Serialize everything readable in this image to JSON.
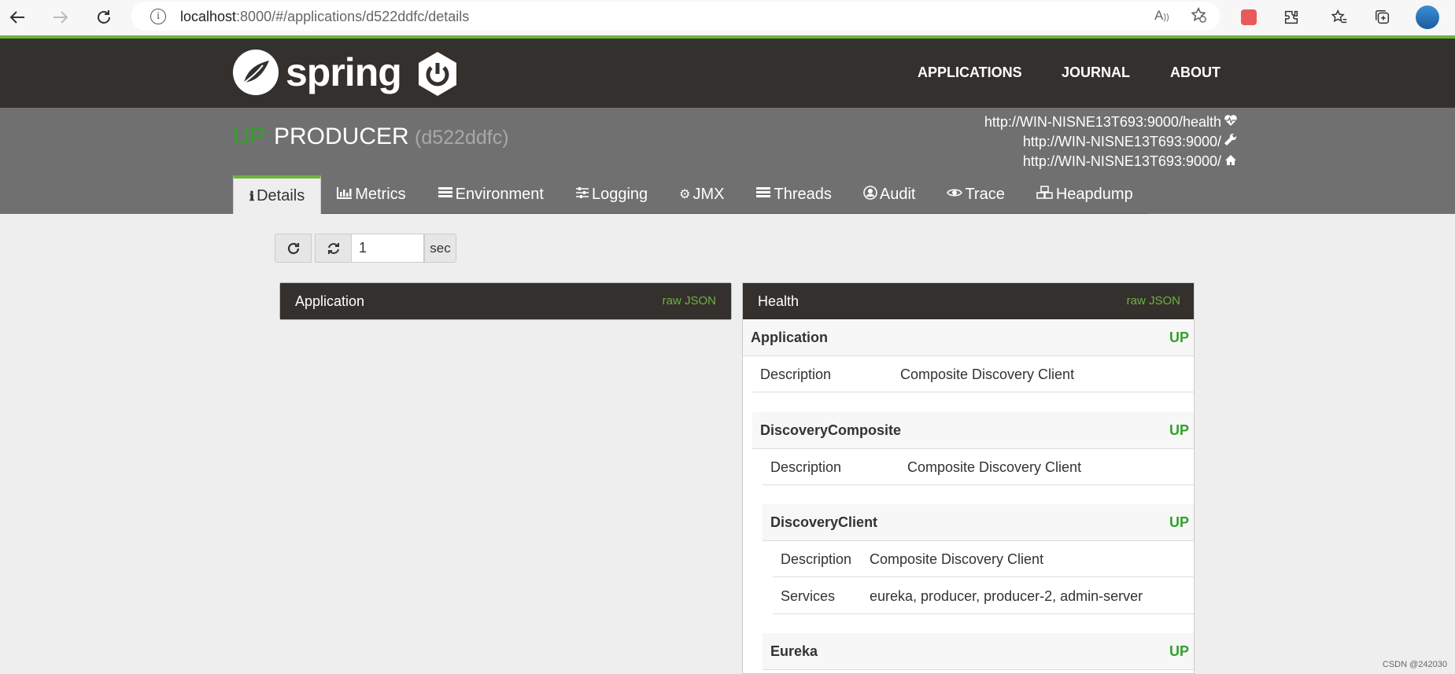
{
  "browser": {
    "url_host": "localhost",
    "url_path": ":8000/#/applications/d522ddfc/details",
    "read_aloud": "A̅"
  },
  "header": {
    "logo_text": "spring",
    "nav": [
      "APPLICATIONS",
      "JOURNAL",
      "ABOUT"
    ]
  },
  "app": {
    "status": "UP",
    "name": "PRODUCER",
    "id": "(d522ddfc)",
    "health_url": "http://WIN-NISNE13T693:9000/health",
    "management_url": "http://WIN-NISNE13T693:9000/",
    "service_url": "http://WIN-NISNE13T693:9000/"
  },
  "tabs": [
    {
      "label": "Details",
      "icon": "info-icon"
    },
    {
      "label": "Metrics",
      "icon": "bar-chart-icon"
    },
    {
      "label": "Environment",
      "icon": "list-icon"
    },
    {
      "label": "Logging",
      "icon": "sliders-icon"
    },
    {
      "label": "JMX",
      "icon": "cogs-icon"
    },
    {
      "label": "Threads",
      "icon": "list-icon"
    },
    {
      "label": "Audit",
      "icon": "user-circle-icon"
    },
    {
      "label": "Trace",
      "icon": "eye-icon"
    },
    {
      "label": "Heapdump",
      "icon": "cubes-icon"
    }
  ],
  "toolbar": {
    "interval_value": "1",
    "interval_unit": "sec"
  },
  "application_panel": {
    "title": "Application",
    "raw_link": "raw JSON"
  },
  "health_panel": {
    "title": "Health",
    "raw_link": "raw JSON",
    "application": {
      "name": "Application",
      "status": "UP",
      "desc_label": "Description",
      "desc_value": "Composite Discovery Client"
    },
    "discovery_composite": {
      "name": "DiscoveryComposite",
      "status": "UP",
      "desc_label": "Description",
      "desc_value": "Composite Discovery Client"
    },
    "discovery_client": {
      "name": "DiscoveryClient",
      "status": "UP",
      "desc_label": "Description",
      "desc_value": "Composite Discovery Client",
      "services_label": "Services",
      "services_value": "eureka, producer, producer-2, admin-server"
    },
    "eureka": {
      "name": "Eureka",
      "status": "UP"
    }
  },
  "watermark": "CSDN @242030"
}
